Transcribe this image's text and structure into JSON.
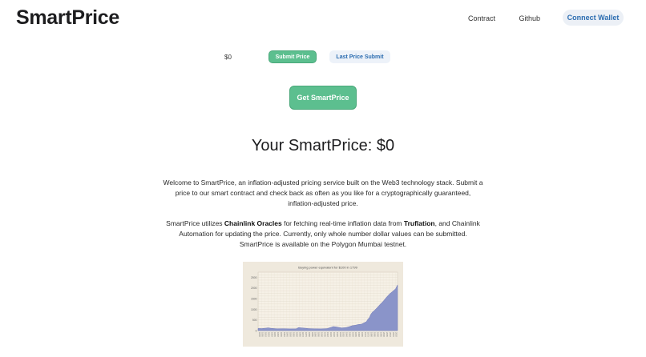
{
  "header": {
    "brand": "SmartPrice",
    "nav": {
      "contract": "Contract",
      "github": "Github"
    },
    "connect_wallet": "Connect Wallet"
  },
  "form": {
    "price_value": "$0",
    "submit_label": "Submit Price",
    "last_submit_label": "Last Price Submit",
    "get_label": "Get SmartPrice"
  },
  "result": {
    "headline": "Your SmartPrice: $0"
  },
  "intro": {
    "p1": "Welcome to SmartPrice, an inflation-adjusted pricing service built on the Web3 technology stack. Submit a price to our smart contract and check back as often as you like for a cryptographically guaranteed, inflation-adjusted price.",
    "p2_a": "SmartPrice utilizes ",
    "p2_b": "Chainlink Oracles",
    "p2_c": " for fetching real-time inflation data from ",
    "p2_d": "Truflation",
    "p2_e": ", and Chainlink Automation for updating the price. Currently, only whole number dollar values can be submitted. SmartPrice is available on the Polygon Mumbai testnet."
  },
  "colors": {
    "accent_green": "#5cbf8f",
    "accent_blue": "#2b6cb0",
    "chart_fill": "#8a94c9"
  },
  "chart_data": {
    "type": "area",
    "title": "Buying power equivalent for $100 in 1799",
    "y_ticks": [
      "0",
      "500",
      "1000",
      "1500",
      "2000",
      "2500"
    ],
    "ylim": [
      0,
      2750
    ],
    "xlim": [
      1799,
      2023
    ],
    "series": [
      {
        "x": [
          1799,
          1805,
          1812,
          1815,
          1820,
          1830,
          1840,
          1850,
          1860,
          1864,
          1866,
          1880,
          1890,
          1900,
          1910,
          1917,
          1920,
          1925,
          1933,
          1940,
          1945,
          1950,
          1955,
          1960,
          1965,
          1970,
          1973,
          1975,
          1978,
          1980,
          1983,
          1985,
          1990,
          1995,
          2000,
          2005,
          2010,
          2015,
          2020,
          2023
        ],
        "values": [
          100,
          95,
          115,
          130,
          105,
          85,
          90,
          80,
          82,
          140,
          135,
          95,
          85,
          80,
          95,
          160,
          190,
          170,
          125,
          140,
          180,
          230,
          250,
          285,
          300,
          375,
          420,
          520,
          620,
          760,
          880,
          920,
          1070,
          1230,
          1380,
          1560,
          1720,
          1840,
          1970,
          2150
        ]
      }
    ]
  }
}
